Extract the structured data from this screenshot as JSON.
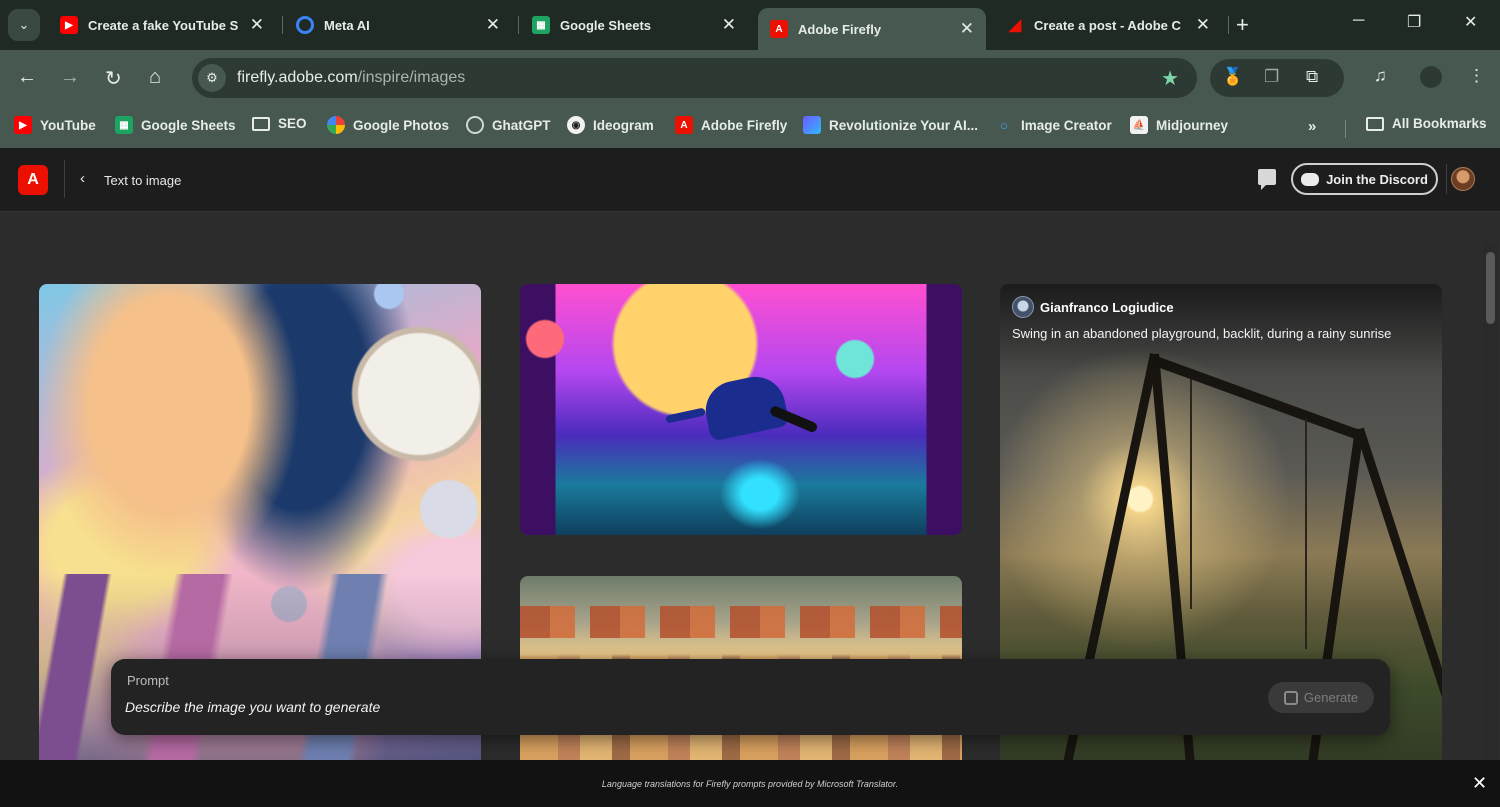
{
  "browser": {
    "tabs": [
      {
        "label": "Create a fake YouTube S",
        "icon": "youtube-icon",
        "color": "#ff0000"
      },
      {
        "label": "Meta AI",
        "icon": "meta-ai-icon",
        "color": "#3b82f6"
      },
      {
        "label": "Google Sheets",
        "icon": "google-sheets-icon",
        "color": "#1ea362"
      },
      {
        "label": "Adobe Firefly",
        "icon": "adobe-firefly-icon",
        "color": "#eb1000",
        "active": true
      },
      {
        "label": "Create a post - Adobe C",
        "icon": "adobe-icon",
        "color": "#eb1000"
      }
    ],
    "url_host": "firefly.adobe.com",
    "url_path": "/inspire/images",
    "bookmarks": [
      {
        "label": "YouTube",
        "icon": "youtube-icon"
      },
      {
        "label": "Google Sheets",
        "icon": "google-sheets-icon"
      },
      {
        "label": "SEO",
        "icon": "folder-icon"
      },
      {
        "label": "Google Photos",
        "icon": "google-photos-icon"
      },
      {
        "label": "GhatGPT",
        "icon": "chatgpt-icon"
      },
      {
        "label": "Ideogram",
        "icon": "ideogram-icon"
      },
      {
        "label": "Adobe Firefly",
        "icon": "adobe-firefly-icon"
      },
      {
        "label": "Revolutionize Your AI...",
        "icon": "revolutionize-icon"
      },
      {
        "label": "Image Creator",
        "icon": "image-creator-icon"
      },
      {
        "label": "Midjourney",
        "icon": "midjourney-icon"
      }
    ],
    "bookmarks_more": "»",
    "all_bookmarks": "All Bookmarks"
  },
  "app": {
    "back_title": "Text to image",
    "discord_label": "Join the Discord"
  },
  "gallery": {
    "featured": {
      "author": "Gianfranco Logiudice",
      "prompt": "Swing in an abandoned playground, backlit, during a rainy sunrise"
    }
  },
  "prompt": {
    "label": "Prompt",
    "placeholder": "Describe the image you want to generate",
    "generate_label": "Generate"
  },
  "footer": {
    "text": "Language translations for Firefly prompts provided by Microsoft Translator."
  },
  "colors": {
    "accent": "#eb1000",
    "star": "#7fd4a8"
  }
}
